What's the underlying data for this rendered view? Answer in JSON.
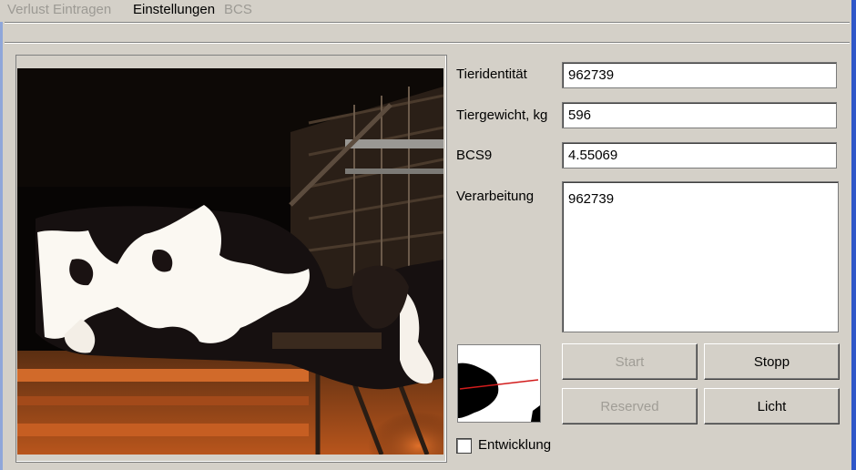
{
  "menu": {
    "items": [
      {
        "label": "Verlust Eintragen",
        "state": "disabled"
      },
      {
        "label": "Einstellungen",
        "state": "active"
      },
      {
        "label": "BCS",
        "state": "disabled"
      }
    ]
  },
  "form": {
    "animal_id_label": "Tieridentität",
    "animal_id_value": "962739",
    "weight_label": "Tiergewicht, kg",
    "weight_value": "596",
    "bcs_label": "BCS9",
    "bcs_value": "4.55069",
    "processing_label": "Verarbeitung",
    "processing_value": "962739"
  },
  "buttons": {
    "start": "Start",
    "stop": "Stopp",
    "reserved": "Reserved",
    "light": "Licht"
  },
  "checkbox": {
    "label": "Entwicklung",
    "checked": false
  },
  "colors": {
    "window_bg": "#d4d0c8",
    "frame_accent": "#2f57c8",
    "disabled_text": "#a09d96"
  }
}
